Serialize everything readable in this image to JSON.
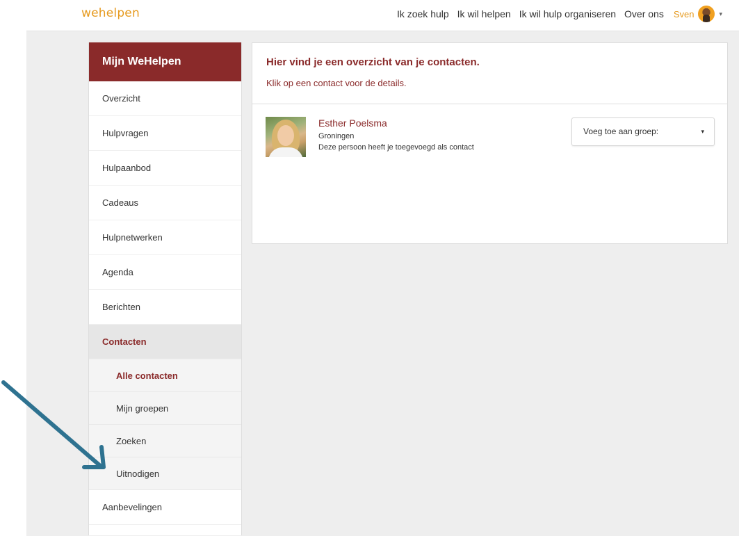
{
  "header": {
    "logo": "wehelpen",
    "nav": [
      "Ik zoek hulp",
      "Ik wil helpen",
      "Ik wil hulp organiseren",
      "Over ons"
    ],
    "user_name": "Sven",
    "caret": "▾"
  },
  "sidebar": {
    "title": "Mijn WeHelpen",
    "items": [
      {
        "label": "Overzicht"
      },
      {
        "label": "Hulpvragen"
      },
      {
        "label": "Hulpaanbod"
      },
      {
        "label": "Cadeaus"
      },
      {
        "label": "Hulpnetwerken"
      },
      {
        "label": "Agenda"
      },
      {
        "label": "Berichten"
      },
      {
        "label": "Contacten",
        "active": true
      }
    ],
    "subitems": [
      {
        "label": "Alle contacten",
        "active": true
      },
      {
        "label": "Mijn groepen"
      },
      {
        "label": "Zoeken"
      },
      {
        "label": "Uitnodigen"
      }
    ],
    "after": [
      {
        "label": "Aanbevelingen"
      }
    ]
  },
  "main": {
    "title": "Hier vind je een overzicht van je contacten.",
    "subtitle": "Klik op een contact voor de details.",
    "contacts": [
      {
        "name": "Esther Poelsma",
        "city": "Groningen",
        "note": "Deze persoon heeft je toegevoegd als contact",
        "group_select": "Voeg toe aan groep:",
        "caret": "▾"
      }
    ]
  },
  "colors": {
    "brand": "#e69a1e",
    "accent": "#8a2a2a",
    "arrow": "#2e7290",
    "background": "#eeeeee"
  },
  "icons": {
    "user_avatar": "avatar",
    "dropdown": "chevron-down-icon",
    "annotation": "arrow-icon"
  }
}
